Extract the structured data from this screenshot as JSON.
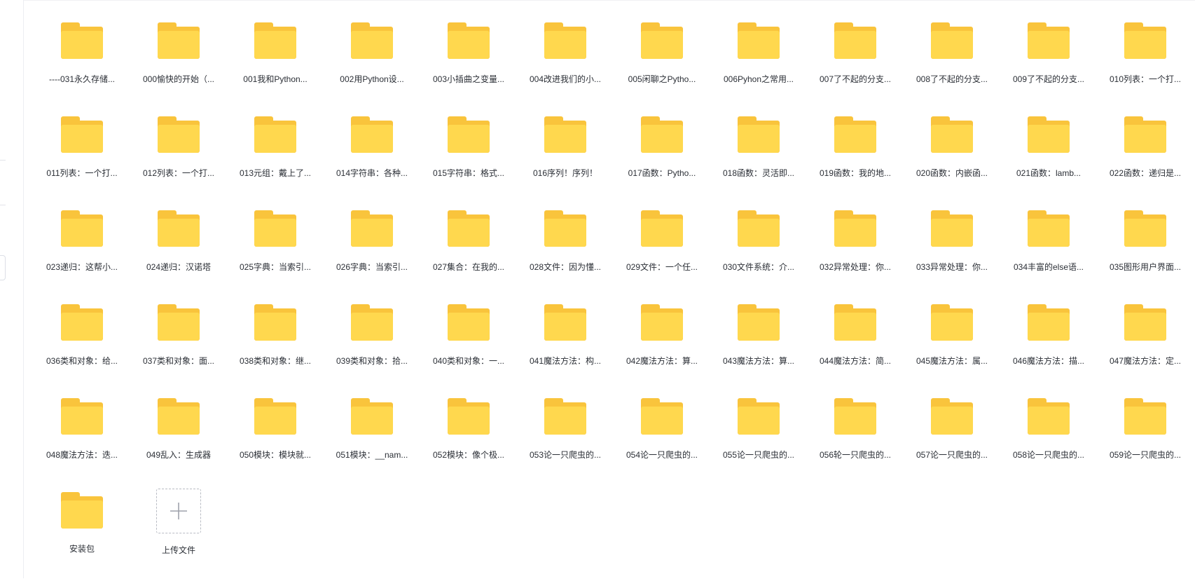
{
  "folders": [
    "----031永久存储...",
    "000愉快的开始（...",
    "001我和Python...",
    "002用Python设...",
    "003小插曲之变量...",
    "004改进我们的小...",
    "005闲聊之Pytho...",
    "006Pyhon之常用...",
    "007了不起的分支...",
    "008了不起的分支...",
    "009了不起的分支...",
    "010列表：一个打...",
    "011列表：一个打...",
    "012列表：一个打...",
    "013元组：戴上了...",
    "014字符串：各种...",
    "015字符串：格式...",
    "016序列！序列！",
    "017函数：Pytho...",
    "018函数：灵活即...",
    "019函数：我的地...",
    "020函数：内嵌函...",
    "021函数：lamb...",
    "022函数：递归是...",
    "023递归：这帮小...",
    "024递归：汉诺塔",
    "025字典：当索引...",
    "026字典：当索引...",
    "027集合：在我的...",
    "028文件：因为懂...",
    "029文件：一个任...",
    "030文件系统：介...",
    "032异常处理：你...",
    "033异常处理：你...",
    "034丰富的else语...",
    "035图形用户界面...",
    "036类和对象：给...",
    "037类和对象：面...",
    "038类和对象：继...",
    "039类和对象：拾...",
    "040类和对象：一...",
    "041魔法方法：构...",
    "042魔法方法：算...",
    "043魔法方法：算...",
    "044魔法方法：简...",
    "045魔法方法：属...",
    "046魔法方法：描...",
    "047魔法方法：定...",
    "048魔法方法：迭...",
    "049乱入：生成器",
    "050模块：模块就...",
    "051模块：__nam...",
    "052模块：像个极...",
    "053论一只爬虫的...",
    "054论一只爬虫的...",
    "055论一只爬虫的...",
    "056轮一只爬虫的...",
    "057论一只爬虫的...",
    "058论一只爬虫的...",
    "059论一只爬虫的...",
    "安装包"
  ],
  "upload": {
    "label": "上传文件",
    "icon": "plus-icon"
  },
  "colors": {
    "folder_front": "#ffd84e",
    "folder_back": "#f9c43c",
    "label_text": "#2b2f36"
  }
}
